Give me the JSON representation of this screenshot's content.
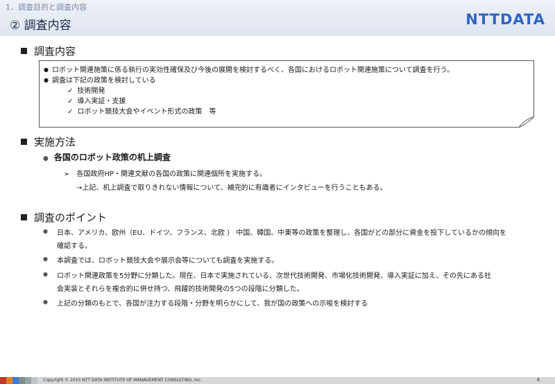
{
  "header": {
    "breadcrumb": "1．調査目的と調査内容",
    "title": "② 調査内容",
    "logo": "NTTDATA"
  },
  "section1": {
    "heading": "調査内容",
    "bullets": [
      "ロボット関連施策に係る執行の実効性確保及び今後の展開を検討するべく、各国におけるロボット関連施策について調査を行う。",
      "調査は下記の政策を検討している"
    ],
    "checks": [
      "技術開発",
      "導入実証・支援",
      "ロボット競技大会やイベント形式の政策　等"
    ]
  },
  "section2": {
    "heading": "実施方法",
    "sub_heading": "各国のロボット政策の机上調査",
    "arrow_item": "各国政府HP・関連文献の各国の政策に関連個所を実施する。",
    "note": "→上記、机上調査で取りきれない情報について、補完的に有識者にインタビューを行うこともある。"
  },
  "section3": {
    "heading": "調査のポイント",
    "points": [
      [
        "日本、アメリカ、欧州（EU、ドイツ、フランス、北欧 ） 中国、韓国、中東等の政策を整理し、各国がどの部分に資金を投下しているかの傾向を",
        "確認する。"
      ],
      [
        "本調査では、ロボット競技大会や展示会等についても調査を実施する。"
      ],
      [
        "ロボット関連政策を5分野に分類した。現在、日本で実施されている、次世代技術開発、市場化技術開発、導入実証に加え、その先にある社",
        "会実装とそれらを複合的に併せ持つ、飛躍的技術開発の5つの段階に分類した。"
      ],
      [
        "上記の分類のもとで、各国が注力する段階・分野を明らかにして、我が国の政策への示唆を検討する"
      ]
    ]
  },
  "footer": {
    "copyright": "Copyright © 2015 NTT DATA INSTITUTE OF MANAGEMENT CONSULTING, Inc.",
    "page": "4"
  },
  "colors": {
    "accent": "#2f65c4",
    "stripes": [
      "#c0392b",
      "#e67e22",
      "#3a7bd5",
      "#7f8c8d",
      "#95a5a6",
      "#bdc3c7"
    ]
  }
}
